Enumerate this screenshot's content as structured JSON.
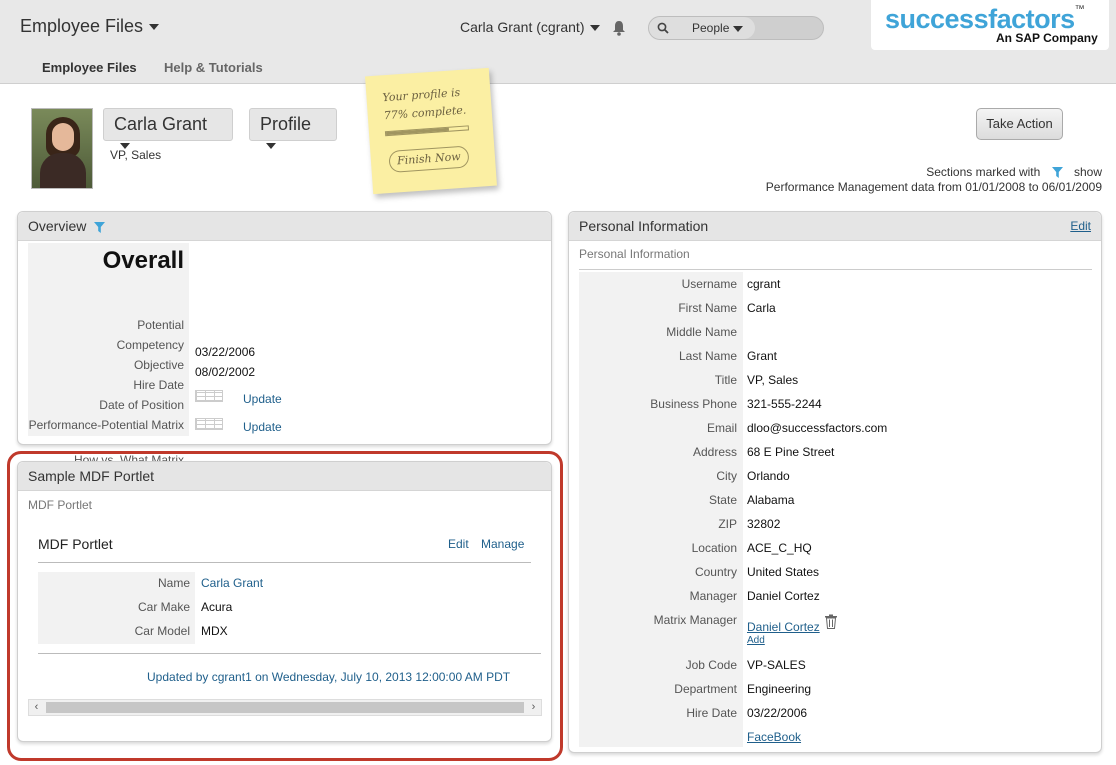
{
  "header": {
    "app_title": "Employee Files",
    "user_menu": "Carla Grant (cgrant)",
    "search_scope": "People",
    "logo_main": "successfactors",
    "logo_tm": "™",
    "logo_sub": "An SAP Company",
    "nav": [
      {
        "label": "Employee Files",
        "active": true
      },
      {
        "label": "Help & Tutorials",
        "active": false
      }
    ]
  },
  "profile": {
    "name": "Carla Grant",
    "menu": "Profile",
    "title": "VP, Sales",
    "sticky_line1": "Your profile is",
    "sticky_line2": "77% complete.",
    "completion": 0.77,
    "finish_label": "Finish Now",
    "take_action": "Take Action",
    "marked_note_1": "Sections marked with",
    "marked_note_show": "show",
    "marked_note_2": "Performance Management data from 01/01/2008 to 06/01/2009"
  },
  "overview": {
    "title": "Overview",
    "overall": "Overall",
    "rows": [
      {
        "label": "Potential",
        "value": ""
      },
      {
        "label": "Competency",
        "value": ""
      },
      {
        "label": "Objective",
        "value": ""
      },
      {
        "label": "Hire Date",
        "value": "03/22/2006"
      },
      {
        "label": "Date of Position",
        "value": "08/02/2002"
      }
    ],
    "matrix1_label": "Performance-Potential Matrix",
    "matrix2_label": "How vs. What Matrix",
    "update_label": "Update"
  },
  "mdf": {
    "title": "Sample MDF Portlet",
    "subtitle": "MDF Portlet",
    "inner_title": "MDF Portlet",
    "edit": "Edit",
    "manage": "Manage",
    "rows": [
      {
        "label": "Name",
        "value": "Carla Grant"
      },
      {
        "label": "Car Make",
        "value": "Acura"
      },
      {
        "label": "Car Model",
        "value": "MDX"
      }
    ],
    "updated": "Updated by cgrant1 on Wednesday, July 10, 2013 12:00:00 AM PDT"
  },
  "personal": {
    "title": "Personal Information",
    "edit": "Edit",
    "subtitle": "Personal Information",
    "rows": [
      {
        "label": "Username",
        "value": "cgrant"
      },
      {
        "label": "First Name",
        "value": "Carla"
      },
      {
        "label": "Middle Name",
        "value": ""
      },
      {
        "label": "Last Name",
        "value": "Grant"
      },
      {
        "label": "Title",
        "value": "VP, Sales"
      },
      {
        "label": "Business Phone",
        "value": "321-555-2244"
      },
      {
        "label": "Email",
        "value": "dloo@successfactors.com"
      },
      {
        "label": "Address",
        "value": "68 E Pine Street"
      },
      {
        "label": "City",
        "value": "Orlando"
      },
      {
        "label": "State",
        "value": "Alabama"
      },
      {
        "label": "ZIP",
        "value": "32802"
      },
      {
        "label": "Location",
        "value": "ACE_C_HQ"
      },
      {
        "label": "Country",
        "value": "United States"
      },
      {
        "label": "Manager",
        "value": "Daniel Cortez"
      }
    ],
    "matrix_manager_label": "Matrix Manager",
    "matrix_manager_value": "Daniel Cortez",
    "add_label": "Add",
    "rows2": [
      {
        "label": "Job Code",
        "value": "VP-SALES"
      },
      {
        "label": "Department",
        "value": "Engineering"
      },
      {
        "label": "Hire Date",
        "value": "03/22/2006"
      }
    ],
    "facebook": "FaceBook"
  },
  "colors": {
    "accent": "#3fa4d8",
    "link": "#1f5f8b",
    "highlight_ring": "#c0392b"
  }
}
